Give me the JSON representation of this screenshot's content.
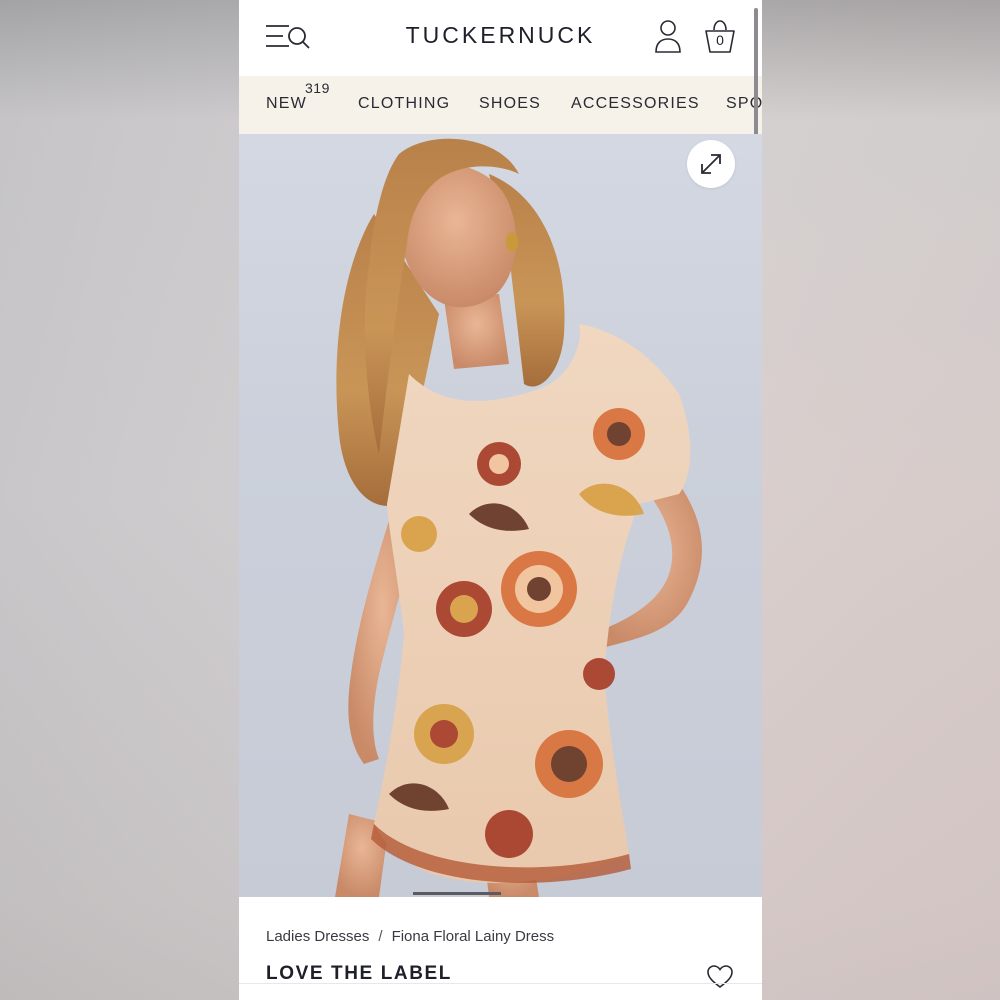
{
  "header": {
    "logo": "TUCKERNUCK",
    "bag_count": "0",
    "icons": [
      "menu-icon",
      "search-icon",
      "account-icon",
      "bag-icon"
    ]
  },
  "nav": {
    "items": [
      {
        "label": "NEW",
        "badge": "319"
      },
      {
        "label": "CLOTHING"
      },
      {
        "label": "SHOES"
      },
      {
        "label": "ACCESSORIES"
      },
      {
        "label": "SPO"
      }
    ]
  },
  "hero": {
    "expand_icon": "expand-icon",
    "dress_colors": {
      "base": "#f1d9c2",
      "orange": "#d8743f",
      "rust": "#a8422e",
      "gold": "#d9a24a",
      "brown": "#6a3b2a"
    }
  },
  "product": {
    "breadcrumb": [
      "Ladies Dresses",
      "Fiona Floral Lainy Dress"
    ],
    "breadcrumb_separator": "/",
    "brand": "LOVE THE LABEL",
    "wishlist_icon": "heart-icon"
  }
}
